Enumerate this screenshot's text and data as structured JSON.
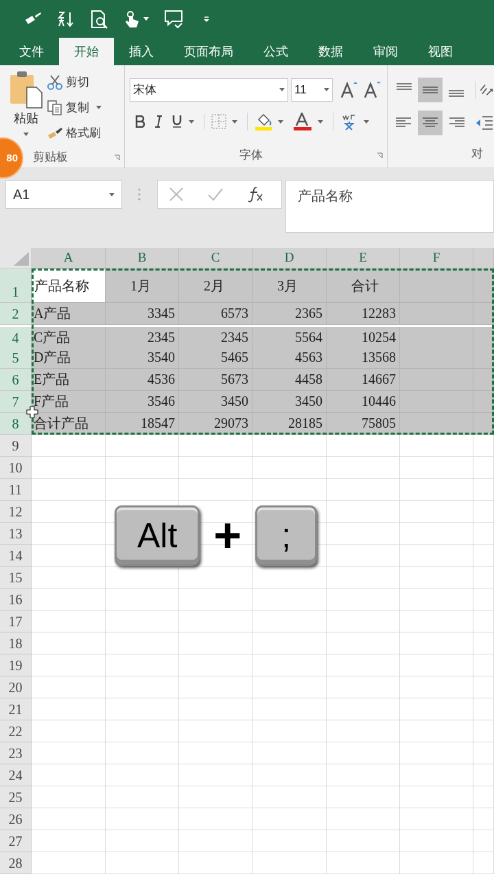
{
  "tabs": [
    {
      "label": "文件",
      "selected": false
    },
    {
      "label": "开始",
      "selected": true
    },
    {
      "label": "插入",
      "selected": false
    },
    {
      "label": "页面布局",
      "selected": false
    },
    {
      "label": "公式",
      "selected": false
    },
    {
      "label": "数据",
      "selected": false
    },
    {
      "label": "审阅",
      "selected": false
    },
    {
      "label": "视图",
      "selected": false
    }
  ],
  "clipboard": {
    "paste": "粘贴",
    "cut": "剪切",
    "copy": "复制",
    "format_painter": "格式刷",
    "group_label": "剪贴板"
  },
  "font": {
    "name": "宋体",
    "size": "11",
    "group_label": "字体"
  },
  "alignment": {
    "group_label": "对"
  },
  "badge": "80",
  "name_box": "A1",
  "formula": "产品名称",
  "columns": [
    "A",
    "B",
    "C",
    "D",
    "E",
    "F"
  ],
  "copy_marquee": true,
  "rows": [
    {
      "number": "1",
      "selected": true,
      "first_cell_active": true,
      "hidden_before": false,
      "cells": [
        "产品名称",
        "1月",
        "2月",
        "3月",
        "合计"
      ]
    },
    {
      "number": "2",
      "selected": true,
      "first_cell_active": false,
      "hidden_before": false,
      "cells": [
        "A产品",
        "3345",
        "6573",
        "2365",
        "12283"
      ]
    },
    {
      "number": "4",
      "selected": true,
      "first_cell_active": false,
      "hidden_before": true,
      "cells": [
        "C产品",
        "2345",
        "2345",
        "5564",
        "10254"
      ]
    },
    {
      "number": "5",
      "selected": true,
      "first_cell_active": false,
      "hidden_before": false,
      "cells": [
        "D产品",
        "3540",
        "5465",
        "4563",
        "13568"
      ]
    },
    {
      "number": "6",
      "selected": true,
      "first_cell_active": false,
      "hidden_before": false,
      "cells": [
        "E产品",
        "4536",
        "5673",
        "4458",
        "14667"
      ]
    },
    {
      "number": "7",
      "selected": true,
      "first_cell_active": false,
      "hidden_before": false,
      "cells": [
        "F产品",
        "3546",
        "3450",
        "3450",
        "10446"
      ]
    },
    {
      "number": "8",
      "selected": true,
      "first_cell_active": false,
      "hidden_before": false,
      "cells": [
        "合计产品",
        "18547",
        "29073",
        "28185",
        "75805"
      ]
    },
    {
      "number": "9",
      "selected": false,
      "first_cell_active": false,
      "hidden_before": false,
      "cells": []
    },
    {
      "number": "10",
      "selected": false,
      "first_cell_active": false,
      "hidden_before": false,
      "cells": []
    },
    {
      "number": "11",
      "selected": false,
      "first_cell_active": false,
      "hidden_before": false,
      "cells": []
    },
    {
      "number": "12",
      "selected": false,
      "first_cell_active": false,
      "hidden_before": false,
      "cells": []
    },
    {
      "number": "13",
      "selected": false,
      "first_cell_active": false,
      "hidden_before": false,
      "cells": []
    },
    {
      "number": "14",
      "selected": false,
      "first_cell_active": false,
      "hidden_before": false,
      "cells": []
    },
    {
      "number": "15",
      "selected": false,
      "first_cell_active": false,
      "hidden_before": false,
      "cells": []
    },
    {
      "number": "16",
      "selected": false,
      "first_cell_active": false,
      "hidden_before": false,
      "cells": []
    },
    {
      "number": "17",
      "selected": false,
      "first_cell_active": false,
      "hidden_before": false,
      "cells": []
    },
    {
      "number": "18",
      "selected": false,
      "first_cell_active": false,
      "hidden_before": false,
      "cells": []
    },
    {
      "number": "19",
      "selected": false,
      "first_cell_active": false,
      "hidden_before": false,
      "cells": []
    },
    {
      "number": "20",
      "selected": false,
      "first_cell_active": false,
      "hidden_before": false,
      "cells": []
    },
    {
      "number": "21",
      "selected": false,
      "first_cell_active": false,
      "hidden_before": false,
      "cells": []
    },
    {
      "number": "22",
      "selected": false,
      "first_cell_active": false,
      "hidden_before": false,
      "cells": []
    },
    {
      "number": "23",
      "selected": false,
      "first_cell_active": false,
      "hidden_before": false,
      "cells": []
    },
    {
      "number": "24",
      "selected": false,
      "first_cell_active": false,
      "hidden_before": false,
      "cells": []
    },
    {
      "number": "25",
      "selected": false,
      "first_cell_active": false,
      "hidden_before": false,
      "cells": []
    },
    {
      "number": "26",
      "selected": false,
      "first_cell_active": false,
      "hidden_before": false,
      "cells": []
    },
    {
      "number": "27",
      "selected": false,
      "first_cell_active": false,
      "hidden_before": false,
      "cells": []
    },
    {
      "number": "28",
      "selected": false,
      "first_cell_active": false,
      "hidden_before": false,
      "cells": []
    }
  ],
  "keys": [
    {
      "kind": "key",
      "label": "Alt"
    },
    {
      "kind": "plus",
      "label": "+"
    },
    {
      "kind": "key",
      "label": ";"
    }
  ]
}
